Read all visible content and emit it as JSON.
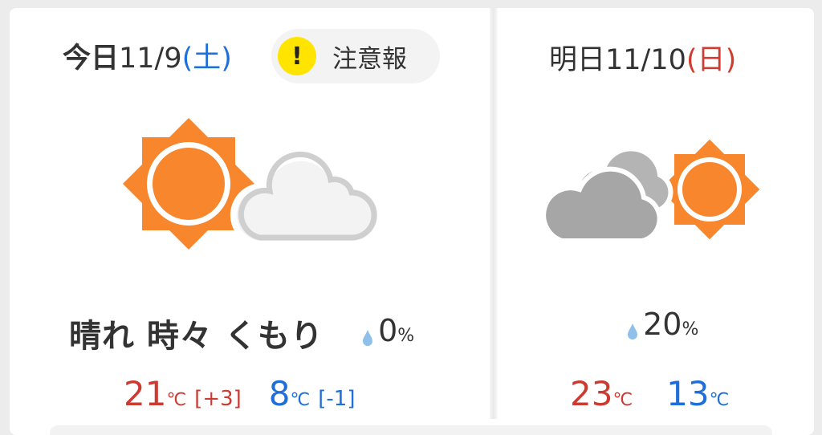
{
  "today": {
    "relative": "今日",
    "date": "11/9",
    "weekday_open": "(",
    "weekday": "土",
    "weekday_close": ")",
    "warning": {
      "label": "注意報",
      "icon": "exclamation-icon",
      "color": "#ffe400"
    },
    "weather_icon": "sun-partly-cloudy-icon",
    "weather_text": "晴れ 時々 くもり",
    "rain": {
      "value": "0",
      "unit": "%"
    },
    "high": {
      "value": "21",
      "unit": "℃",
      "diff": "[+3]"
    },
    "low": {
      "value": "8",
      "unit": "℃",
      "diff": "[-1]"
    }
  },
  "tomorrow": {
    "relative": "明日",
    "date": "11/10",
    "weekday_open": "(",
    "weekday": "日",
    "weekday_close": ")",
    "weather_icon": "cloudy-then-sun-icon",
    "rain": {
      "value": "20",
      "unit": "%"
    },
    "high": {
      "value": "23",
      "unit": "℃"
    },
    "low": {
      "value": "13",
      "unit": "℃"
    }
  },
  "colors": {
    "sun": "#f7862c",
    "cloud_light": "#f3f3f3",
    "cloud_gray": "#a6a6a6",
    "high_temp": "#cc3b32",
    "low_temp": "#1e6fd9",
    "drop": "#8fc0ea"
  }
}
